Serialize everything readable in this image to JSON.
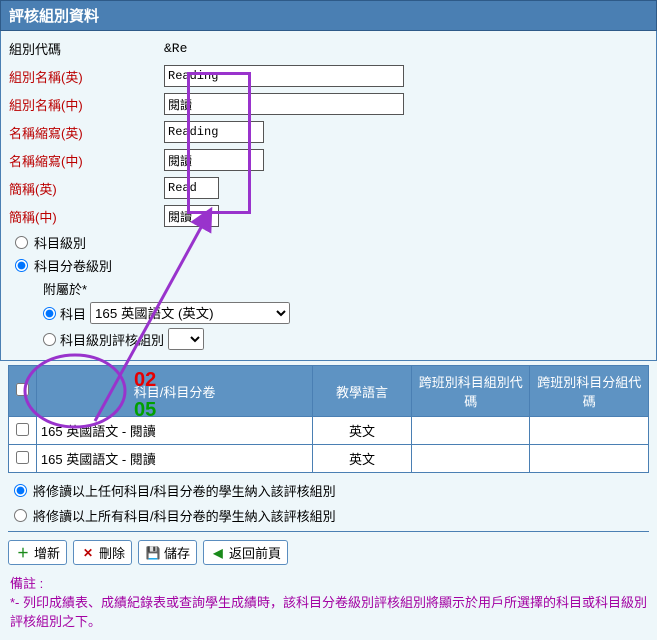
{
  "header": {
    "title": "評核組別資料"
  },
  "form": {
    "labels": {
      "code": "組別代碼",
      "name_en": "組別名稱(英)",
      "name_ch": "組別名稱(中)",
      "abbr_en": "名稱縮寫(英)",
      "abbr_ch": "名稱縮寫(中)",
      "short_en": "簡稱(英)",
      "short_ch": "簡稱(中)"
    },
    "values": {
      "code": "&Re",
      "name_en": "Reading",
      "name_ch": "閱讀",
      "abbr_en": "Reading",
      "abbr_ch": "閱讀",
      "short_en": "Read",
      "short_ch": "閱讀"
    }
  },
  "scope": {
    "opt1": "科目級別",
    "opt2": "科目分卷級別",
    "attach": "附屬於*",
    "subopt1": "科目",
    "subopt1_select": "165 英國語文 (英文)",
    "subopt2": "科目級別評核組別"
  },
  "table": {
    "headers": {
      "subject": "科目/科目分卷",
      "lang": "教學語言",
      "cross1": "跨班別科目組別代碼",
      "cross2": "跨班別科目分組代碼"
    },
    "rows": [
      {
        "subject": "165 英國語文 - 閱讀",
        "lang": "英文",
        "cross1": "",
        "cross2": ""
      },
      {
        "subject": "165 英國語文 - 閱讀",
        "lang": "英文",
        "cross1": "",
        "cross2": ""
      }
    ]
  },
  "bottom": {
    "opt_any": "將修讀以上任何科目/科目分卷的學生納入該評核組別",
    "opt_all": "將修讀以上所有科目/科目分卷的學生納入該評核組別"
  },
  "buttons": {
    "add": "增新",
    "delete": "刪除",
    "save": "儲存",
    "back": "返回前頁"
  },
  "remarks": {
    "title": "備註 :",
    "body": "*- 列印成績表、成績紀錄表或查詢學生成績時，該科目分卷級別評核組別將顯示於用戶所選擇的科目或科目級別評核組別之下。"
  },
  "annotations": {
    "red": "02",
    "green": "05"
  }
}
